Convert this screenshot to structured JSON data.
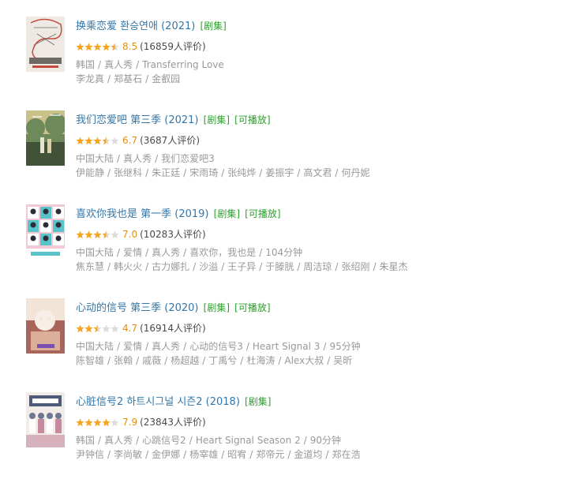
{
  "items": [
    {
      "title": "换乘恋爱 환승연애 (2021)",
      "tags": [
        "[剧集]"
      ],
      "rating": 8.5,
      "score": "8.5",
      "count": "(16859人评价)",
      "meta": [
        "韩国",
        "真人秀",
        "Transferring Love"
      ],
      "cast": [
        "李龙真",
        "郑基石",
        "金叡园"
      ],
      "poster_colors": [
        "#eeeae3",
        "#c44b3c",
        "#6d6a66"
      ]
    },
    {
      "title": "我们恋爱吧 第三季 (2021)",
      "tags": [
        "[剧集]",
        "[可播放]"
      ],
      "rating": 6.7,
      "score": "6.7",
      "count": "(3687人评价)",
      "meta": [
        "中国大陆",
        "真人秀",
        "我们恋爱吧3"
      ],
      "cast": [
        "伊能静",
        "张继科",
        "朱正廷",
        "宋雨琦",
        "张纯烨",
        "姜振宇",
        "高文君",
        "何丹妮"
      ],
      "poster_colors": [
        "#6f8a5a",
        "#c9c08a",
        "#2f3b2a"
      ]
    },
    {
      "title": "喜欢你我也是 第一季 (2019)",
      "tags": [
        "[剧集]",
        "[可播放]"
      ],
      "rating": 7.0,
      "score": "7.0",
      "count": "(10283人评价)",
      "meta": [
        "中国大陆",
        "爱情",
        "真人秀",
        "喜欢你，我也是",
        "104分钟"
      ],
      "cast": [
        "焦东慧",
        "韩火火",
        "古力娜扎",
        "沙溢",
        "王子异",
        "于滕胱",
        "周洁琼",
        "张绍刚",
        "朱星杰"
      ],
      "poster_colors": [
        "#58c4c9",
        "#f4c9d6",
        "#2d2d3a"
      ]
    },
    {
      "title": "心动的信号 第三季 (2020)",
      "tags": [
        "[剧集]",
        "[可播放]"
      ],
      "rating": 4.7,
      "score": "4.7",
      "count": "(16914人评价)",
      "meta": [
        "中国大陆",
        "爱情",
        "真人秀",
        "心动的信号3",
        "Heart Signal 3",
        "95分钟"
      ],
      "cast": [
        "陈智雄",
        "张翰",
        "戚薇",
        "杨超越",
        "丁禹兮",
        "杜海涛",
        "Alex大叔",
        "吴昕"
      ],
      "poster_colors": [
        "#e7c1a9",
        "#a8665a",
        "#f3e4d8"
      ]
    },
    {
      "title": "心脏信号2 하트시그널 시즌2 (2018)",
      "tags": [
        "[剧集]"
      ],
      "rating": 7.9,
      "score": "7.9",
      "count": "(23843人评价)",
      "meta": [
        "韩国",
        "真人秀",
        "心跳信号2",
        "Heart Signal Season 2",
        "90分钟"
      ],
      "cast": [
        "尹钟信",
        "李尚敏",
        "金伊娜",
        "杨宰雄",
        "昭宥",
        "郑帝元",
        "金道均",
        "郑在浩"
      ],
      "poster_colors": [
        "#f1ece7",
        "#c58aa0",
        "#4d5a7a"
      ]
    }
  ]
}
